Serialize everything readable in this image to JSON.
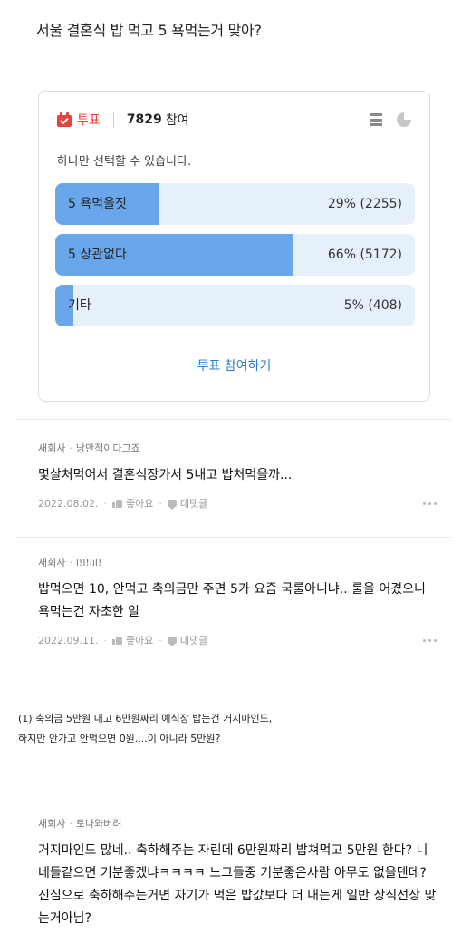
{
  "post": {
    "title": "서울 결혼식 밥 먹고 5 욕먹는거 맞아?"
  },
  "poll": {
    "label": "투표",
    "count": "7829",
    "count_suffix": "참여",
    "instruction": "하나만 선택할 수 있습니다.",
    "options": [
      {
        "text": "5 욕먹을짓",
        "result": "29% (2255)",
        "percent": 29
      },
      {
        "text": "5 상관없다",
        "result": "66% (5172)",
        "percent": 66
      },
      {
        "text": "기타",
        "result": "5% (408)",
        "percent": 5
      }
    ],
    "vote_button": "투표 참여하기",
    "fill_color": "#6aa7ea",
    "track_color": "#e6f0fb",
    "accent_color": "#e0463f",
    "icons": [
      "vote-box-icon",
      "list-icon",
      "pie-chart-icon"
    ]
  },
  "comments": [
    {
      "company": "새회사",
      "nick": "낭만적이다그죠",
      "text": "몇살처먹어서 결혼식장가서 5내고 밥처먹을까...",
      "date": "2022.08.02.",
      "like": "좋아요",
      "reply": "대댓글"
    },
    {
      "company": "새회사",
      "nick": "l!l!lil!",
      "text": "밥먹으면 10, 안먹고 축의금만 주면 5가 요즘 국룰아니냐.. 룰을 어겼으니 욕먹는건 자초한 일",
      "date": "2022.09.11.",
      "like": "좋아요",
      "reply": "대댓글"
    },
    {
      "company": "새회사",
      "nick": "토나와버려",
      "text": "거지마인드 많네..  축하해주는 자린데 6만원짜리 밥쳐먹고 5만원 한다? 니네들같으면 기분좋겠냐ㅋㅋㅋㅋ 느그들중 기분좋은사람 아무도 없을텐데? 진심으로 축하해주는거면 자기가 먹은 밥값보다 더 내는게 일반 상식선상 맞는거아님?"
    }
  ],
  "note": {
    "line1": "(1) 축의금 5만원 내고 6만원짜리 예식장 밥는건 거지마인드,",
    "line2": "하지만 안가고 안먹으면 0원....이 아니라 5만원?"
  }
}
